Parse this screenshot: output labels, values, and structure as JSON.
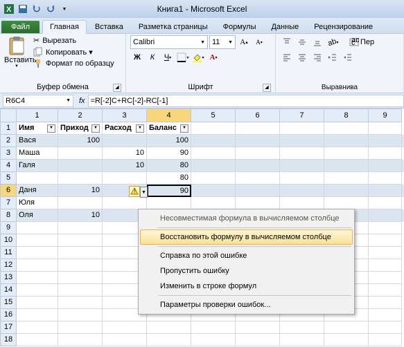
{
  "title": "Книга1 - Microsoft Excel",
  "tabs": {
    "file": "Файл",
    "home": "Главная",
    "insert": "Вставка",
    "pagelayout": "Разметка страницы",
    "formulas": "Формулы",
    "data": "Данные",
    "review": "Рецензирование"
  },
  "clipboard": {
    "paste": "Вставить",
    "cut": "Вырезать",
    "copy": "Копировать ▾",
    "format_painter": "Формат по образцу",
    "label": "Буфер обмена"
  },
  "font": {
    "name": "Calibri",
    "size": "11",
    "label": "Шрифт"
  },
  "align": {
    "wrap": "Пер",
    "label": "Выравнива"
  },
  "namebox": "R6C4",
  "fx": "fx",
  "formula": "=R[-2]C+RC[-2]-RC[-1]",
  "cols": [
    "1",
    "2",
    "3",
    "4",
    "5",
    "6",
    "7",
    "8",
    "9"
  ],
  "rows": [
    "1",
    "2",
    "3",
    "4",
    "5",
    "6",
    "7",
    "8",
    "9",
    "10",
    "11",
    "12",
    "13",
    "14",
    "15",
    "16",
    "17",
    "18"
  ],
  "table": {
    "headers": [
      "Имя",
      "Приход",
      "Расход",
      "Баланс"
    ],
    "rows": [
      {
        "name": "Вася",
        "in": "100",
        "out": "",
        "bal": "100"
      },
      {
        "name": "Маша",
        "in": "",
        "out": "10",
        "bal": "90"
      },
      {
        "name": "Галя",
        "in": "",
        "out": "10",
        "bal": "80"
      },
      {
        "name": "",
        "in": "",
        "out": "",
        "bal": "80"
      },
      {
        "name": "Даня",
        "in": "10",
        "out": "",
        "bal": "90"
      },
      {
        "name": "Юля",
        "in": "",
        "out": "",
        "bal": ""
      },
      {
        "name": "Оля",
        "in": "10",
        "out": "",
        "bal": ""
      }
    ]
  },
  "menu": {
    "title": "Несовместимая формула в вычисляемом столбце",
    "restore": "Восстановить формулу в вычисляемом столбце",
    "help": "Справка по этой ошибке",
    "ignore": "Пропустить ошибку",
    "edit": "Изменить в строке формул",
    "options": "Параметры проверки ошибок..."
  }
}
